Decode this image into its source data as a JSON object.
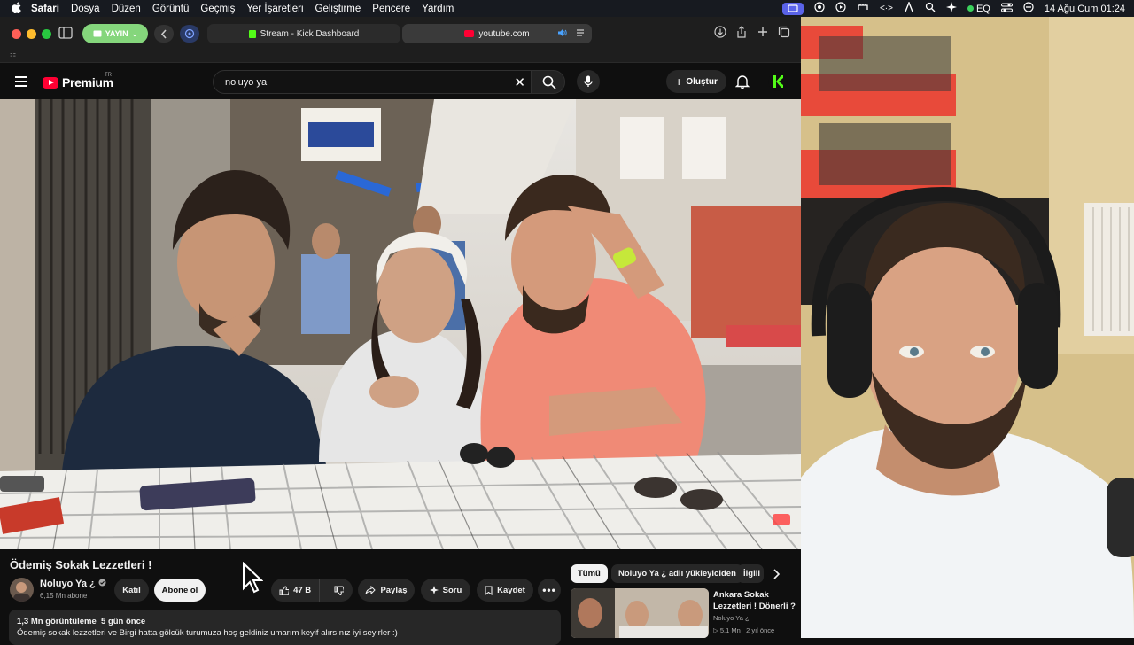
{
  "menubar": {
    "apple": "",
    "items": [
      "Safari",
      "Dosya",
      "Düzen",
      "Görüntü",
      "Geçmiş",
      "Yer İşaretleri",
      "Geliştirme",
      "Pencere",
      "Yardım"
    ],
    "eq": "EQ",
    "datetime": "14 Ağu Cum  01:24"
  },
  "safari": {
    "profile_label": "YAYIN",
    "tab1_title": "Stream - Kick Dashboard",
    "tab2_title": "youtube.com"
  },
  "youtube": {
    "logo_text": "Premium",
    "logo_country": "TR",
    "search_value": "noluyo ya",
    "create_label": "Oluştur",
    "video_title": "Ödemiş Sokak Lezzetleri !",
    "channel_name": "Noluyo Ya ¿",
    "channel_subs": "6,15 Mn abone",
    "join_label": "Katıl",
    "subscribe_label": "Abone ol",
    "like_count": "47 B",
    "share_label": "Paylaş",
    "ask_label": "Soru",
    "save_label": "Kaydet",
    "views": "1,3 Mn görüntüleme",
    "age": "5 gün önce",
    "description": "Ödemiş sokak lezzetleri ve Birgi hatta gölcük turumuza hoş geldiniz umarım keyif alırsınız iyi seyirler :)",
    "chips": [
      "Tümü",
      "Noluyo Ya ¿ adlı yükleyiciden",
      "İlgili"
    ],
    "rec": {
      "title": "Ankara Sokak Lezzetleri ! Dönerli ?",
      "channel": "Noluyo Ya ¿",
      "views": "5,1 Mn",
      "age": "2 yıl önce"
    }
  },
  "colors": {
    "yt_red": "#ff0033",
    "kick_green": "#53fc18",
    "profile_green": "#85d67c",
    "shirt_pink": "#f08a76"
  }
}
